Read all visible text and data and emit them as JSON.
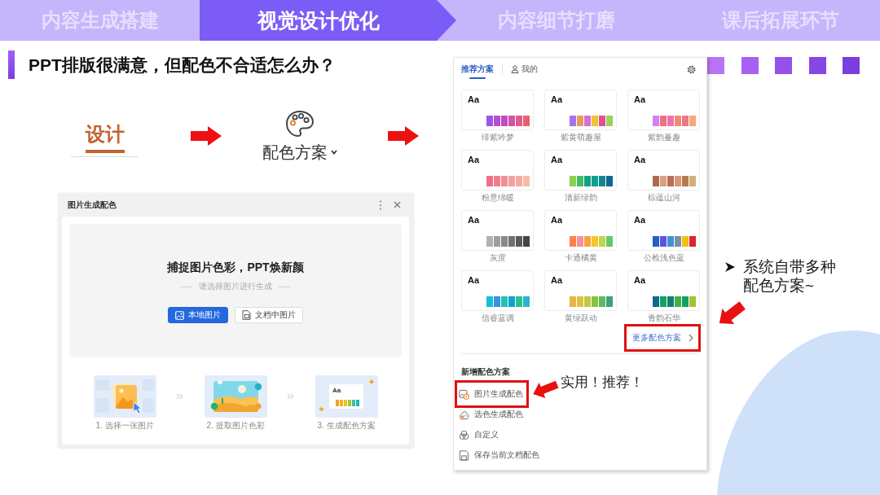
{
  "nav_tabs": [
    {
      "label": "内容生成搭建",
      "selected": false
    },
    {
      "label": "视觉设计优化",
      "selected": true
    },
    {
      "label": "内容细节打磨",
      "selected": false
    },
    {
      "label": "课后拓展环节",
      "selected": false
    }
  ],
  "heading": "PPT排版很满意，但配色不合适怎么办？",
  "flow": {
    "design_tab": "设计",
    "color_scheme_button": "配色方案"
  },
  "image_dialog": {
    "title": "图片生成配色",
    "headline": "捕捉图片色彩，PPT焕新颜",
    "hint": "请选择图片进行生成",
    "buttons": [
      {
        "label": "本地图片",
        "kind": "primary"
      },
      {
        "label": "文档中图片",
        "kind": "secondary"
      }
    ],
    "steps": [
      {
        "label": "1. 选择一张图片",
        "kind": "select"
      },
      {
        "label": "2. 提取图片色彩",
        "kind": "extract"
      },
      {
        "label": "3. 生成配色方案",
        "kind": "generate",
        "sample": "Aa"
      }
    ]
  },
  "scheme_panel": {
    "tabs": [
      {
        "label": "推荐方案",
        "kind": "text",
        "selected": true
      },
      {
        "label": "我的",
        "kind": "account",
        "selected": false
      }
    ],
    "schemes": [
      {
        "name": "绯紫吟梦",
        "sample": "Aa",
        "swatches": [
          {
            "color": "#9b55e6"
          },
          {
            "color": "#b24fd6"
          },
          {
            "color": "#c24cc2"
          },
          {
            "color": "#d055a6"
          },
          {
            "color": "#e05a8a"
          },
          {
            "color": "#e8606e"
          }
        ]
      },
      {
        "name": "紫黄萌趣屋",
        "sample": "Aa",
        "swatches": [
          {
            "color": "#a772f0"
          },
          {
            "color": "#e89a5e"
          },
          {
            "color": "#d56fd6"
          },
          {
            "color": "#f2c233"
          },
          {
            "color": "#e0508e"
          },
          {
            "color": "#9fd15a"
          }
        ]
      },
      {
        "name": "紫韵蔓趣",
        "sample": "Aa",
        "swatches": [
          {
            "color": "#d57ef2"
          },
          {
            "color": "#f06f80"
          },
          {
            "color": "#e974b4"
          },
          {
            "color": "#f08a70"
          },
          {
            "color": "#e8788a"
          },
          {
            "color": "#f7a77a"
          }
        ]
      },
      {
        "name": "粉意绵暖",
        "sample": "Aa",
        "swatches": [
          {
            "color": "#ef6f84"
          },
          {
            "color": "#f07f8c"
          },
          {
            "color": "#f28f96"
          },
          {
            "color": "#f3a0a0"
          },
          {
            "color": "#f4aaa4"
          },
          {
            "color": "#f7bba6"
          }
        ]
      },
      {
        "name": "清新绿韵",
        "sample": "Aa",
        "swatches": [
          {
            "color": "#8fcf4f"
          },
          {
            "color": "#3fbf62"
          },
          {
            "color": "#10a27e"
          },
          {
            "color": "#11a08f"
          },
          {
            "color": "#12878f"
          },
          {
            "color": "#106894"
          }
        ]
      },
      {
        "name": "棕蕴山河",
        "sample": "Aa",
        "swatches": [
          {
            "color": "#ad6a4a"
          },
          {
            "color": "#d9a07e"
          },
          {
            "color": "#b86e5a"
          },
          {
            "color": "#d9967a"
          },
          {
            "color": "#b07e4e"
          },
          {
            "color": "#d2b07c"
          }
        ]
      },
      {
        "name": "灰度",
        "sample": "Aa",
        "swatches": [
          {
            "color": "#b2b2b2"
          },
          {
            "color": "#9e9e9e"
          },
          {
            "color": "#898989"
          },
          {
            "color": "#727272"
          },
          {
            "color": "#5a5a5a"
          },
          {
            "color": "#444444"
          }
        ]
      },
      {
        "name": "卡通橘黄",
        "sample": "Aa",
        "swatches": [
          {
            "color": "#ff8152"
          },
          {
            "color": "#f6909e"
          },
          {
            "color": "#f7a33e"
          },
          {
            "color": "#f6c532"
          },
          {
            "color": "#c9d244"
          },
          {
            "color": "#5fc873"
          }
        ]
      },
      {
        "name": "公检浅色蓝",
        "sample": "Aa",
        "swatches": [
          {
            "color": "#1f62c4"
          },
          {
            "color": "#5f52e2"
          },
          {
            "color": "#4592d0"
          },
          {
            "color": "#7990a8"
          },
          {
            "color": "#efc111"
          },
          {
            "color": "#e1222f"
          }
        ]
      },
      {
        "name": "信睿蓝调",
        "sample": "Aa",
        "swatches": [
          {
            "color": "#12c0d6"
          },
          {
            "color": "#3a90e4"
          },
          {
            "color": "#22c3b0"
          },
          {
            "color": "#129fd2"
          },
          {
            "color": "#24c48e"
          },
          {
            "color": "#2fb0d2"
          }
        ]
      },
      {
        "name": "黄绿跃动",
        "sample": "Aa",
        "swatches": [
          {
            "color": "#e9b444"
          },
          {
            "color": "#e1c13c"
          },
          {
            "color": "#c3c842"
          },
          {
            "color": "#86c142"
          },
          {
            "color": "#5fb85e"
          },
          {
            "color": "#3fa178"
          }
        ]
      },
      {
        "name": "青韵石华",
        "sample": "Aa",
        "swatches": [
          {
            "color": "#0f6890"
          },
          {
            "color": "#10a35e"
          },
          {
            "color": "#0f8072"
          },
          {
            "color": "#42b046"
          },
          {
            "color": "#10a262"
          },
          {
            "color": "#a4c232"
          }
        ]
      }
    ],
    "more_link": {
      "label": "更多配色方案",
      "highlighted": true
    },
    "new_section": {
      "title": "新增配色方案",
      "items": [
        {
          "label": "图片生成配色",
          "kind": "image",
          "highlighted": true
        },
        {
          "label": "选色生成配色",
          "kind": "picker",
          "highlighted": false
        },
        {
          "label": "自定义",
          "kind": "custom",
          "highlighted": false
        },
        {
          "label": "保存当前文档配色",
          "kind": "save",
          "highlighted": false
        }
      ]
    }
  },
  "annotations": {
    "callout": "实用！推荐！",
    "note": "系统自带多种配色方案~"
  }
}
